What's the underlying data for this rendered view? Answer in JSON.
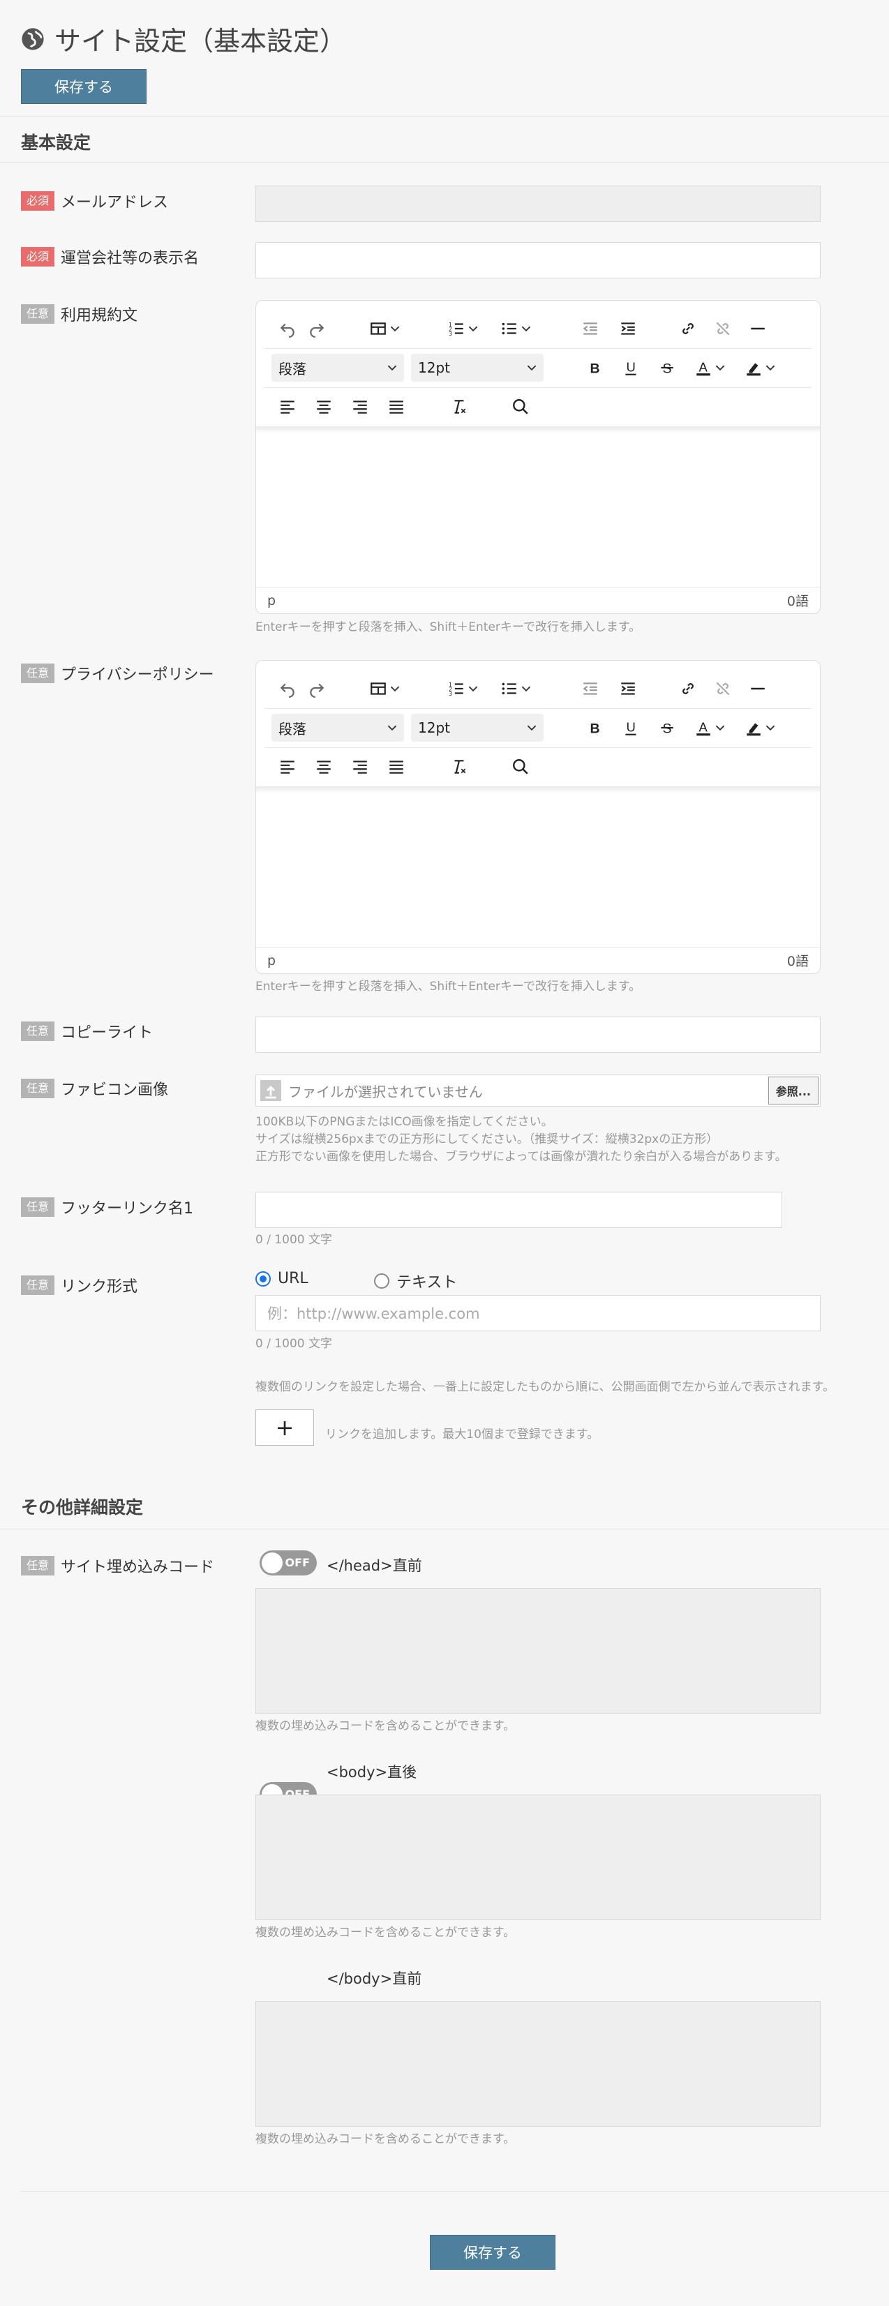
{
  "header": {
    "title": "サイト設定（基本設定）",
    "save_label": "保存する",
    "icon": "globe-icon"
  },
  "basic_section": {
    "title": "基本設定"
  },
  "badges": {
    "required": "必須",
    "optional": "任意"
  },
  "fields": {
    "email": {
      "label": "メールアドレス",
      "value": ""
    },
    "display_name": {
      "label": "運営会社等の表示名",
      "value": ""
    },
    "terms": {
      "label": "利用規約文",
      "status_path": "p",
      "word_count": "0語"
    },
    "privacy": {
      "label": "プライバシーポリシー",
      "status_path": "p",
      "word_count": "0語"
    },
    "copyright": {
      "label": "コピーライト",
      "value": ""
    },
    "favicon": {
      "label": "ファビコン画像",
      "no_file_text": "ファイルが選択されていません",
      "browse_label": "参照...",
      "help": [
        "100KB以下のPNGまたはICO画像を指定してください。",
        "サイズは縦横256pxまでの正方形にしてください。（推奨サイズ：縦横32pxの正方形）",
        "正方形でない画像を使用した場合、ブラウザによっては画像が潰れたり余白が入る場合があります。"
      ]
    },
    "footer_link_name": {
      "label": "フッターリンク名1",
      "counter": "0 / 1000 文字"
    },
    "link_type": {
      "label": "リンク形式",
      "options": [
        "URL",
        "テキスト"
      ],
      "selected": "URL",
      "placeholder": "例：http://www.example.com",
      "counter": "0 / 1000 文字"
    },
    "links_note": "複数個のリンクを設定した場合、一番上に設定したものから順に、公開画面側で左から並んで表示されます。",
    "add_link": {
      "button": "+",
      "note": "リンクを追加します。最大10個まで登録できます。"
    }
  },
  "editor": {
    "block_format": "段落",
    "font_size": "12pt",
    "help": "Enterキーを押すと段落を挿入、Shift＋Enterキーで改行を挿入します。"
  },
  "other_section": {
    "title": "その他詳細設定",
    "embed_label": "サイト埋め込みコード",
    "toggle_off": "OFF",
    "blocks": [
      {
        "position": "</head>直前",
        "help": "複数の埋め込みコードを含めることができます。"
      },
      {
        "position": "<body>直後",
        "help": "複数の埋め込みコードを含めることができます。"
      },
      {
        "position": "</body>直前",
        "help": "複数の埋め込みコードを含めることができます。"
      }
    ]
  },
  "footer": {
    "save_label": "保存する"
  }
}
